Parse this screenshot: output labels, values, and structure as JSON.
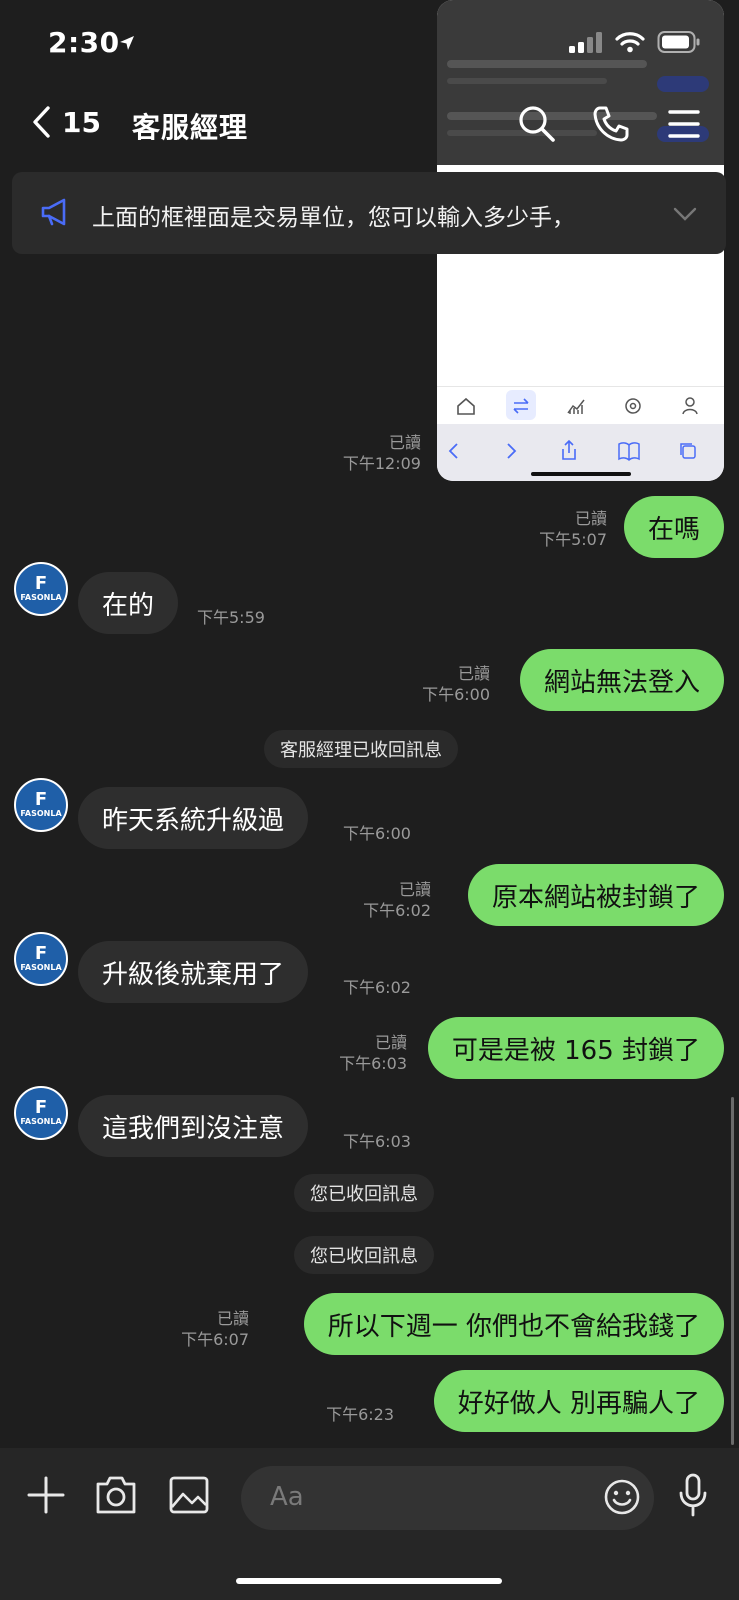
{
  "status": {
    "time": "2:30"
  },
  "header": {
    "back_count": "15",
    "title": "客服經理"
  },
  "announcement": {
    "text": "上面的框裡面是交易單位，您可以輸入多少手，"
  },
  "avatar": {
    "big": "F",
    "small": "FASONLA"
  },
  "messages": [
    {
      "read": "已讀",
      "time": "下午12:09"
    },
    {
      "read": "已讀",
      "time": "下午5:07",
      "text": "在嗎"
    },
    {
      "time": "下午5:59",
      "text": "在的"
    },
    {
      "read": "已讀",
      "time": "下午6:00",
      "text": "網站無法登入"
    },
    {
      "text": "客服經理已收回訊息"
    },
    {
      "time": "下午6:00",
      "text": "昨天系統升級過"
    },
    {
      "read": "已讀",
      "time": "下午6:02",
      "text": "原本網站被封鎖了"
    },
    {
      "time": "下午6:02",
      "text": "升級後就棄用了"
    },
    {
      "read": "已讀",
      "time": "下午6:03",
      "text": "可是是被 165 封鎖了"
    },
    {
      "time": "下午6:03",
      "text": "這我們到沒注意"
    },
    {
      "text": "您已收回訊息"
    },
    {
      "text": "您已收回訊息"
    },
    {
      "read": "已讀",
      "time": "下午6:07",
      "text": "所以下週一 你們也不會給我錢了"
    },
    {
      "time": "下午6:23",
      "text": "好好做人 別再騙人了"
    }
  ],
  "composer": {
    "placeholder": "Aa"
  },
  "colors": {
    "outgoing": "#7bdc6b",
    "incoming": "#2e2e2e",
    "background": "#1e1e1e",
    "link": "#4a6cf7"
  },
  "icons": [
    "location-arrow-icon",
    "signal-icon",
    "wifi-icon",
    "battery-icon",
    "back-chevron-icon",
    "search-icon",
    "phone-icon",
    "menu-icon",
    "megaphone-icon",
    "chevron-down-icon",
    "plus-icon",
    "camera-icon",
    "image-icon",
    "emoji-icon",
    "microphone-icon"
  ]
}
